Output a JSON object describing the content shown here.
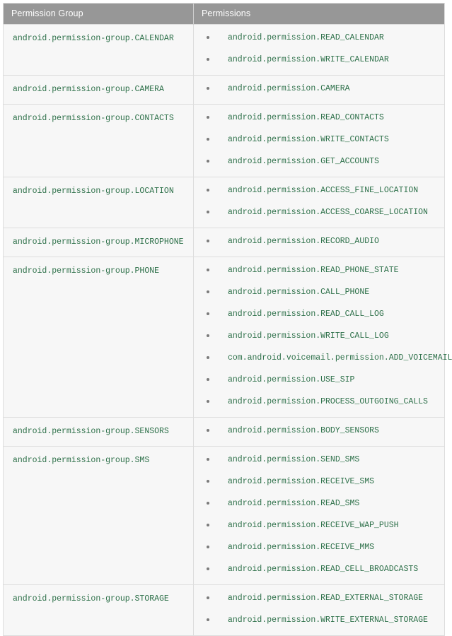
{
  "table": {
    "headers": {
      "group": "Permission Group",
      "permissions": "Permissions"
    },
    "colors": {
      "header_background": "#979797",
      "header_text": "#ffffff",
      "cell_background": "#f7f7f7",
      "cell_text": "#2d7049",
      "border": "#dddddd",
      "bullet": "#7b7b7b"
    },
    "rows": [
      {
        "group": "android.permission-group.CALENDAR",
        "permissions": [
          "android.permission.READ_CALENDAR",
          "android.permission.WRITE_CALENDAR"
        ]
      },
      {
        "group": "android.permission-group.CAMERA",
        "permissions": [
          "android.permission.CAMERA"
        ]
      },
      {
        "group": "android.permission-group.CONTACTS",
        "permissions": [
          "android.permission.READ_CONTACTS",
          "android.permission.WRITE_CONTACTS",
          "android.permission.GET_ACCOUNTS"
        ]
      },
      {
        "group": "android.permission-group.LOCATION",
        "permissions": [
          "android.permission.ACCESS_FINE_LOCATION",
          "android.permission.ACCESS_COARSE_LOCATION"
        ]
      },
      {
        "group": "android.permission-group.MICROPHONE",
        "permissions": [
          "android.permission.RECORD_AUDIO"
        ]
      },
      {
        "group": "android.permission-group.PHONE",
        "permissions": [
          "android.permission.READ_PHONE_STATE",
          "android.permission.CALL_PHONE",
          "android.permission.READ_CALL_LOG",
          "android.permission.WRITE_CALL_LOG",
          "com.android.voicemail.permission.ADD_VOICEMAIL",
          "android.permission.USE_SIP",
          "android.permission.PROCESS_OUTGOING_CALLS"
        ]
      },
      {
        "group": "android.permission-group.SENSORS",
        "permissions": [
          "android.permission.BODY_SENSORS"
        ]
      },
      {
        "group": "android.permission-group.SMS",
        "permissions": [
          "android.permission.SEND_SMS",
          "android.permission.RECEIVE_SMS",
          "android.permission.READ_SMS",
          "android.permission.RECEIVE_WAP_PUSH",
          "android.permission.RECEIVE_MMS",
          "android.permission.READ_CELL_BROADCASTS"
        ]
      },
      {
        "group": "android.permission-group.STORAGE",
        "permissions": [
          "android.permission.READ_EXTERNAL_STORAGE",
          "android.permission.WRITE_EXTERNAL_STORAGE"
        ]
      }
    ]
  }
}
